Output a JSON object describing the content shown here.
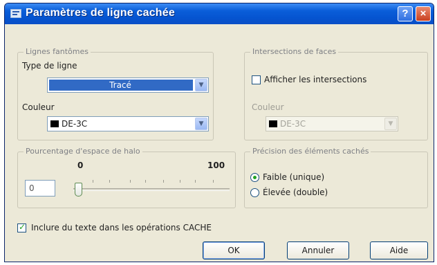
{
  "window": {
    "title": "Paramètres de ligne cachée",
    "help_button": "?",
    "close_button": "×"
  },
  "obscured_lines": {
    "legend": "Lignes fantômes",
    "linetype_label": "Type de ligne",
    "linetype_value": "Tracé",
    "color_label": "Couleur",
    "color_value": "DE-3C"
  },
  "face_intersections": {
    "legend": "Intersections de faces",
    "show_checkbox_label": "Afficher les intersections",
    "show_checked": false,
    "color_label": "Couleur",
    "color_value": "DE-3C"
  },
  "halo_gap": {
    "legend": "Pourcentage d'espace de halo",
    "min_label": "0",
    "max_label": "100",
    "value": "0",
    "slider_fraction": 0
  },
  "hidden_precision": {
    "legend": "Précision des éléments cachés",
    "options": [
      {
        "label": "Faible (unique)",
        "selected": true
      },
      {
        "label": "Élevée (double)",
        "selected": false
      }
    ]
  },
  "include_text": {
    "label": "Inclure du texte dans les opérations CACHE",
    "checked": true
  },
  "buttons": {
    "ok": "OK",
    "cancel": "Annuler",
    "help": "Aide"
  },
  "colors": {
    "titlebar": "#0554d0",
    "dialog_bg": "#ece9d8",
    "selection": "#316ac5",
    "check_green": "#21a121"
  }
}
